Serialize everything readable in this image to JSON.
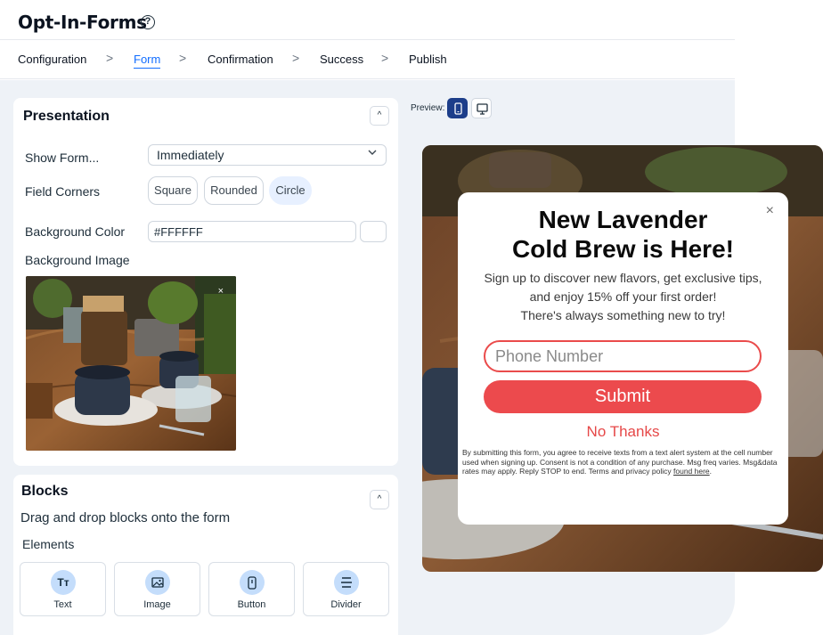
{
  "header": {
    "title": "Opt-In-Forms",
    "help_icon": "?"
  },
  "breadcrumb": {
    "items": [
      {
        "label": "Configuration"
      },
      {
        "label": "Form",
        "active": true
      },
      {
        "label": "Confirmation"
      },
      {
        "label": "Success"
      },
      {
        "label": "Publish"
      }
    ],
    "separator": ">"
  },
  "presentation": {
    "title": "Presentation",
    "collapse_icon": "^",
    "show_form_label": "Show Form...",
    "show_form_value": "Immediately",
    "field_corners_label": "Field Corners",
    "corners": [
      "Square",
      "Rounded",
      "Circle"
    ],
    "corners_selected": "Circle",
    "bg_color_label": "Background Color",
    "bg_color_value": "#FFFFFF",
    "bg_image_label": "Background Image",
    "remove_icon": "×"
  },
  "blocks": {
    "title": "Blocks",
    "collapse_icon": "^",
    "drag_text": "Drag and drop blocks onto the form",
    "elements_label": "Elements",
    "items": [
      {
        "label": "Text",
        "icon": "text-icon",
        "glyph": "Tт"
      },
      {
        "label": "Image",
        "icon": "image-icon",
        "glyph": ""
      },
      {
        "label": "Button",
        "icon": "button-icon",
        "glyph": ""
      },
      {
        "label": "Divider",
        "icon": "divider-icon",
        "glyph": ""
      }
    ]
  },
  "preview": {
    "label": "Preview:",
    "modes": [
      {
        "name": "mobile",
        "icon": "mobile-icon",
        "selected": true
      },
      {
        "name": "desktop",
        "icon": "desktop-icon",
        "selected": false
      }
    ]
  },
  "popup": {
    "close_icon": "×",
    "heading_line1": "New Lavender",
    "heading_line2": "Cold Brew is Here!",
    "body_line1": "Sign up to discover new flavors, get exclusive tips,",
    "body_line2": "and enjoy 15% off your first order!",
    "body_line3": "There's always something new to try!",
    "phone_placeholder": "Phone Number",
    "submit_label": "Submit",
    "no_thanks_label": "No Thanks",
    "legal_text": "By submitting this form, you agree to receive texts from a text alert system at the cell number used when signing up. Consent is not a condition of any purchase. Msg freq varies. Msg&data rates may apply. Reply STOP to end. Terms and privacy policy ",
    "legal_link": "found here",
    "legal_end": "."
  },
  "colors": {
    "accent": "#116dff",
    "submit": "#ec4a4d",
    "preview_selected": "#1d3e8a",
    "block_icon_bg": "#c4ddfb"
  }
}
